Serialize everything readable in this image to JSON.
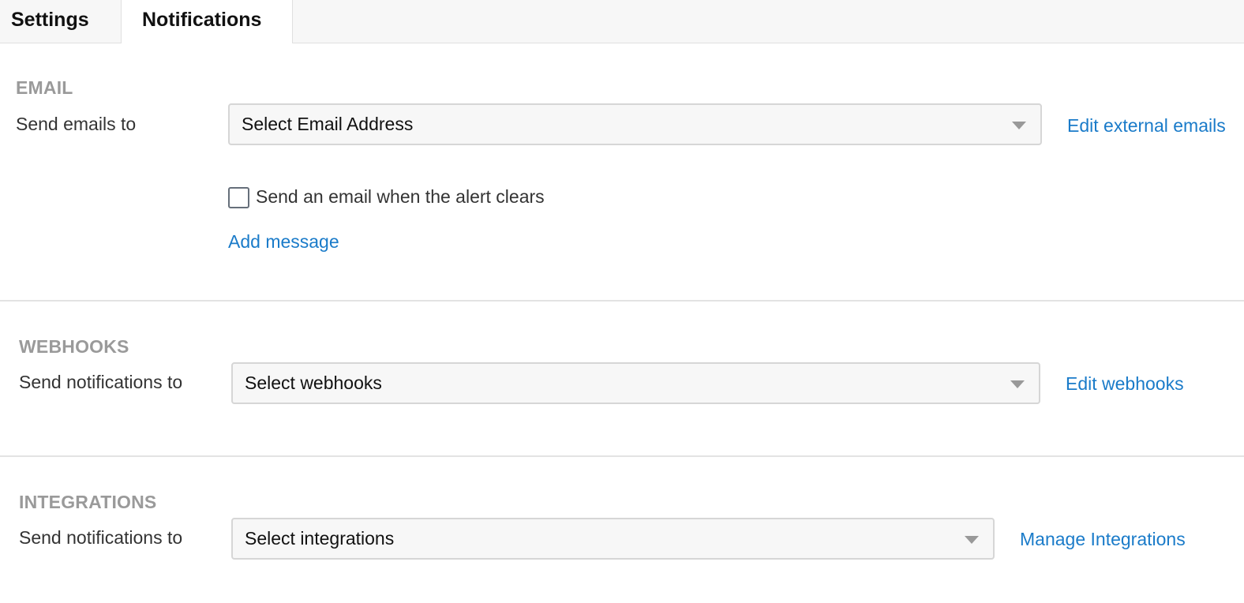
{
  "tabs": {
    "settings": "Settings",
    "notifications": "Notifications"
  },
  "email": {
    "title": "EMAIL",
    "label": "Send emails to",
    "select_value": "Select Email Address",
    "edit_link": "Edit external emails",
    "checkbox_label": "Send an email when the alert clears",
    "checkbox_checked": false,
    "add_message": "Add message"
  },
  "webhooks": {
    "title": "WEBHOOKS",
    "label": "Send notifications to",
    "select_value": "Select webhooks",
    "edit_link": "Edit webhooks"
  },
  "integrations": {
    "title": "INTEGRATIONS",
    "label": "Send notifications to",
    "select_value": "Select integrations",
    "manage_link": "Manage Integrations"
  },
  "colors": {
    "link": "#1a7bc9",
    "section_title": "#9a9a9a"
  }
}
